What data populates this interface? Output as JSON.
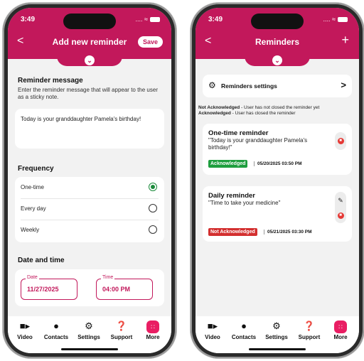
{
  "status": {
    "time": "3:49",
    "signal": "....",
    "wifi": "≈"
  },
  "left": {
    "header": {
      "title": "Add new reminder",
      "back": "<",
      "save": "Save",
      "chevron": "⌄"
    },
    "message": {
      "title": "Reminder message",
      "description": "Enter the reminder message that will appear to the user as a sticky note.",
      "value": "Today is your granddaughter Pamela's birthday!"
    },
    "frequency": {
      "title": "Frequency",
      "options": [
        {
          "label": "One-time",
          "selected": true
        },
        {
          "label": "Every day",
          "selected": false
        },
        {
          "label": "Weekly",
          "selected": false
        }
      ]
    },
    "datetime": {
      "title": "Date and time",
      "date_label": "Date",
      "date_value": "11/27/2025",
      "time_label": "Time",
      "time_value": "04:00 PM"
    }
  },
  "right": {
    "header": {
      "title": "Reminders",
      "back": "<",
      "add": "+",
      "chevron": "⌄"
    },
    "settings_label": "Reminders settings",
    "settings_chevron": ">",
    "legend": {
      "not_ack_key": "Not Acknowledged",
      "not_ack_text": " - User has not closed the reminder yet",
      "ack_key": "Acknowledged",
      "ack_text": " - User has closed the reminder"
    },
    "reminders": [
      {
        "title": "One-time reminder",
        "text": "\"Today is your granddaughter Pamela's birthday!\"",
        "status": "Acknowledged",
        "date": "05/20/2025 03:50 PM"
      },
      {
        "title": "Daily reminder",
        "text": "\"Time to take your medicine\"",
        "status": "Not Acknowledged",
        "date": "05/21/2025 03:30 PM"
      }
    ]
  },
  "nav": {
    "items": [
      {
        "label": "Video",
        "icon": "video-icon"
      },
      {
        "label": "Contacts",
        "icon": "contacts-icon"
      },
      {
        "label": "Settings",
        "icon": "gear-icon"
      },
      {
        "label": "Support",
        "icon": "help-icon"
      },
      {
        "label": "More",
        "icon": "more-icon"
      }
    ]
  },
  "colors": {
    "accent": "#c2185b",
    "acknowledged": "#1e9e3e",
    "not_acknowledged": "#d32f2f",
    "selected_radio": "#1a8a3a"
  }
}
